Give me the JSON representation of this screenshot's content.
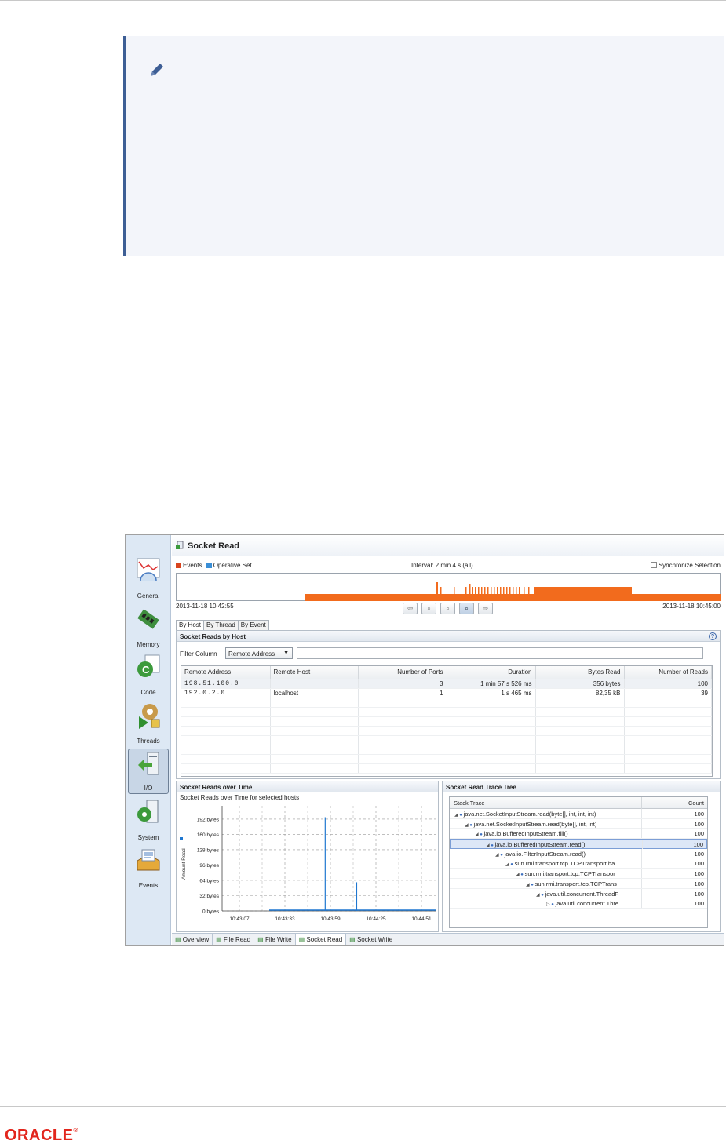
{
  "note": {
    "icon": "pencil-icon"
  },
  "screenshot": {
    "nav": [
      {
        "label": "General",
        "icon": "general-chart-icon"
      },
      {
        "label": "Memory",
        "icon": "memory-chip-icon"
      },
      {
        "label": "Code",
        "icon": "code-icon"
      },
      {
        "label": "Threads",
        "icon": "threads-icon"
      },
      {
        "label": "I/O",
        "icon": "io-icon",
        "active": true
      },
      {
        "label": "System",
        "icon": "system-icon"
      },
      {
        "label": "Events",
        "icon": "events-icon"
      }
    ],
    "title": "Socket Read",
    "legend": {
      "events": "Events",
      "operative_set": "Operative Set",
      "events_color": "#d8441e",
      "operative_color": "#3a8ed6"
    },
    "interval": "Interval: 2 min 4 s (all)",
    "sync_label": "Synchronize Selection",
    "timeline_color": "#f26b1d",
    "start_time": "2013-11-18 10:42:55",
    "end_time": "2013-11-18 10:45:00",
    "subtabs": [
      "By Host",
      "By Thread",
      "By Event"
    ],
    "hosts_panel": {
      "title": "Socket Reads by Host",
      "filter_label": "Filter Column",
      "filter_value": "Remote Address",
      "columns": [
        "Remote Address",
        "Remote Host",
        "Number of Ports",
        "Duration",
        "Bytes Read",
        "Number of Reads"
      ],
      "rows": [
        [
          "198.51.100.0",
          "",
          "3",
          "1 min 57 s 526 ms",
          "356 bytes",
          "100"
        ],
        [
          "192.0.2.0",
          "localhost",
          "1",
          "1 s 465 ms",
          "82,35 kB",
          "39"
        ]
      ]
    },
    "chart_panel": {
      "title": "Socket Reads over Time",
      "subtitle": "Socket Reads over Time for selected hosts"
    },
    "chart_data": {
      "type": "bar",
      "title": "Socket Reads over Time for selected hosts",
      "ylabel": "Amount Read",
      "yticks": [
        "0 bytes",
        "32 bytes",
        "64 bytes",
        "96 bytes",
        "128 bytes",
        "160 bytes",
        "192 bytes"
      ],
      "xticks": [
        "10:43:07",
        "10:43:33",
        "10:43:59",
        "10:44:25",
        "10:44:51"
      ],
      "ylim": [
        0,
        210
      ],
      "series": [
        {
          "x": [
            "10:43:56",
            "10:44:14"
          ],
          "values": [
            196,
            60
          ],
          "color": "#1f77d0"
        }
      ]
    },
    "tree_panel": {
      "title": "Socket Read Trace Tree",
      "columns": [
        "Stack Trace",
        "Count"
      ],
      "rows": [
        {
          "text": "java.net.SocketInputStream.read(byte[], int, int, int)",
          "count": "100",
          "depth": 0
        },
        {
          "text": "java.net.SocketInputStream.read(byte[], int, int)",
          "count": "100",
          "depth": 1
        },
        {
          "text": "java.io.BufferedInputStream.fill()",
          "count": "100",
          "depth": 2
        },
        {
          "text": "java.io.BufferedInputStream.read()",
          "count": "100",
          "depth": 3,
          "selected": true
        },
        {
          "text": "java.io.FilterInputStream.read()",
          "count": "100",
          "depth": 4
        },
        {
          "text": "sun.rmi.transport.tcp.TCPTransport.ha",
          "count": "100",
          "depth": 5
        },
        {
          "text": "sun.rmi.transport.tcp.TCPTranspor",
          "count": "100",
          "depth": 6
        },
        {
          "text": "sun.rmi.transport.tcp.TCPTrans",
          "count": "100",
          "depth": 7
        },
        {
          "text": "java.util.concurrent.ThreadF",
          "count": "100",
          "depth": 8
        },
        {
          "text": "java.util.concurrent.Thre",
          "count": "100",
          "depth": 9
        }
      ]
    },
    "bottom_tabs": [
      "Overview",
      "File Read",
      "File Write",
      "Socket Read",
      "Socket Write"
    ],
    "active_bottom_tab": "Socket Read"
  },
  "footer": {
    "logo_text": "ORACLE",
    "logo_mark": "®"
  }
}
